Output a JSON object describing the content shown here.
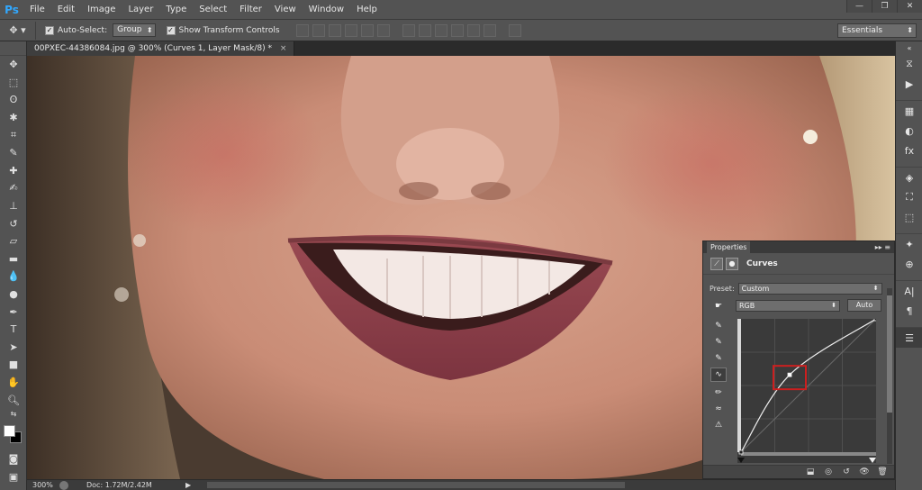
{
  "app": {
    "logo": "Ps"
  },
  "menu": [
    "File",
    "Edit",
    "Image",
    "Layer",
    "Type",
    "Select",
    "Filter",
    "View",
    "Window",
    "Help"
  ],
  "window_controls": [
    "—",
    "❐",
    "✕"
  ],
  "options": {
    "auto_select_label": "Auto-Select:",
    "auto_select_value": "Group",
    "show_transform_label": "Show Transform Controls",
    "workspace": "Essentials"
  },
  "document": {
    "tab_title": "00PXEC-44386084.jpg @ 300% (Curves 1, Layer Mask/8) *",
    "tab_close": "×"
  },
  "status": {
    "zoom": "300%",
    "doc_info": "Doc: 1.72M/2.42M",
    "arrow": "▶"
  },
  "properties": {
    "tab": "Properties",
    "title": "Curves",
    "preset_label": "Preset:",
    "preset_value": "Custom",
    "channel_value": "RGB",
    "auto_label": "Auto",
    "curve_points": [
      [
        0,
        0
      ],
      [
        0.36,
        0.58
      ],
      [
        1,
        1
      ]
    ]
  },
  "colors": {
    "highlight_box": "#cc1f1f",
    "ui_dark": "#535353",
    "canvas_bg": "#282828"
  }
}
